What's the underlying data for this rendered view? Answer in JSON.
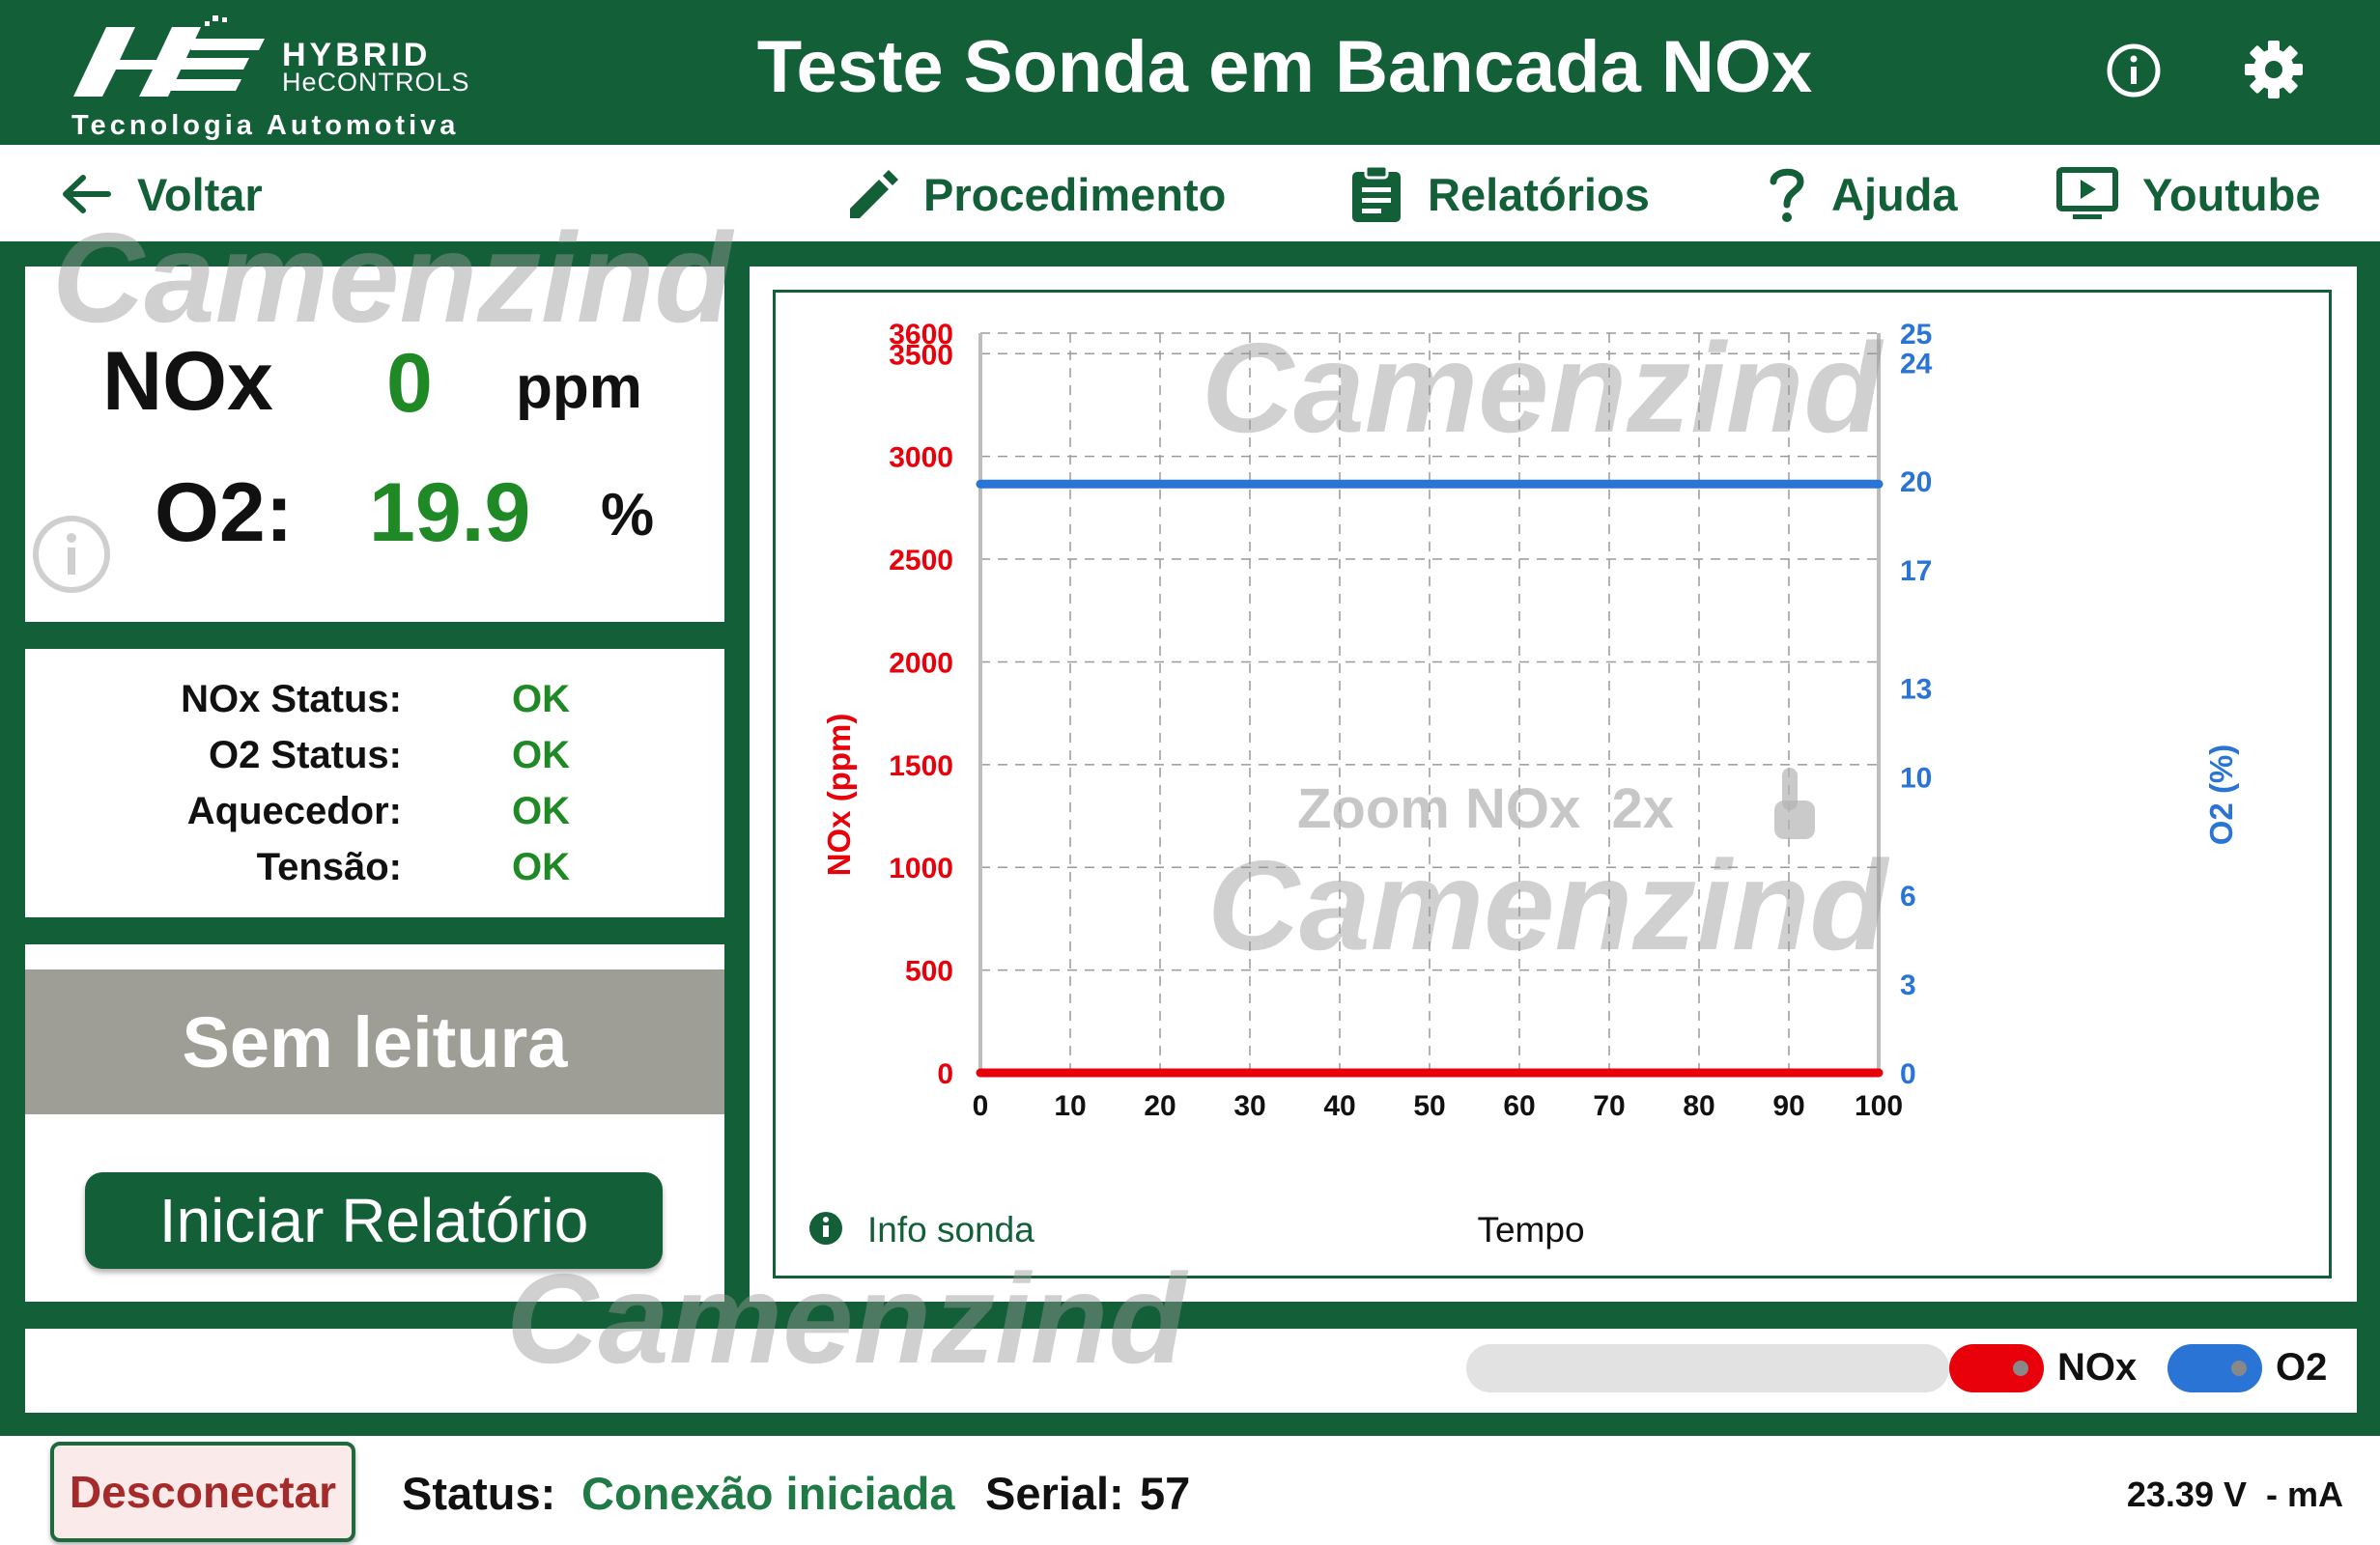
{
  "header": {
    "brand_name": "HYBRID",
    "brand_sub": "HeCONTROLS",
    "brand_tagline": "Tecnologia Automotiva",
    "title": "Teste Sonda em Bancada NOx"
  },
  "toolbar": {
    "back": "Voltar",
    "procedure": "Procedimento",
    "reports": "Relatórios",
    "help": "Ajuda",
    "youtube": "Youtube"
  },
  "watermark": "Camenzind",
  "readings": {
    "nox_label": "NOx",
    "nox_value": "0",
    "nox_unit": "ppm",
    "o2_label": "O2:",
    "o2_value": "19.9",
    "o2_unit": "%"
  },
  "status": [
    {
      "label": "NOx Status:",
      "value": "OK"
    },
    {
      "label": "O2 Status:",
      "value": "OK"
    },
    {
      "label": "Aquecedor:",
      "value": "OK"
    },
    {
      "label": "Tensão:",
      "value": "OK"
    }
  ],
  "actions": {
    "no_reading": "Sem leitura",
    "start_report": "Iniciar Relatório"
  },
  "chart_data": {
    "type": "line",
    "xlabel": "Tempo",
    "ylabel_left": "NOx (ppm)",
    "ylabel_right": "O2 (%)",
    "xlim": [
      0,
      100
    ],
    "x_ticks": [
      0,
      10,
      20,
      30,
      40,
      50,
      60,
      70,
      80,
      90,
      100
    ],
    "ylim_left": [
      0,
      3600
    ],
    "y_ticks_left": [
      0,
      500,
      1000,
      1500,
      2000,
      2500,
      3000,
      3500,
      3600
    ],
    "ylim_right": [
      0,
      25
    ],
    "y_ticks_right": [
      0,
      3,
      6,
      10,
      13,
      17,
      20,
      24,
      25
    ],
    "grid": true,
    "series": [
      {
        "name": "NOx",
        "axis": "left",
        "color": "#e8000b",
        "x": [
          0,
          100
        ],
        "y": [
          0,
          0
        ]
      },
      {
        "name": "O2",
        "axis": "right",
        "color": "#2a74d6",
        "x": [
          0,
          100
        ],
        "y": [
          19.9,
          19.9
        ]
      }
    ],
    "overlay_hint": "Zoom NOx  2x",
    "info_link": "Info sonda"
  },
  "legend": {
    "nox": "NOx",
    "o2": "O2",
    "nox_color": "#e8000b",
    "o2_color": "#2a74d6"
  },
  "footer": {
    "disconnect": "Desconectar",
    "status_label": "Status:",
    "status_value": "Conexão iniciada",
    "serial_label": "Serial:",
    "serial_value": "57",
    "voltage": "23.39 V  - mA"
  },
  "colors": {
    "brand_green": "#125f38",
    "ok_green": "#1f8a25",
    "nox_red": "#e8000b",
    "o2_blue": "#2a74d6"
  }
}
